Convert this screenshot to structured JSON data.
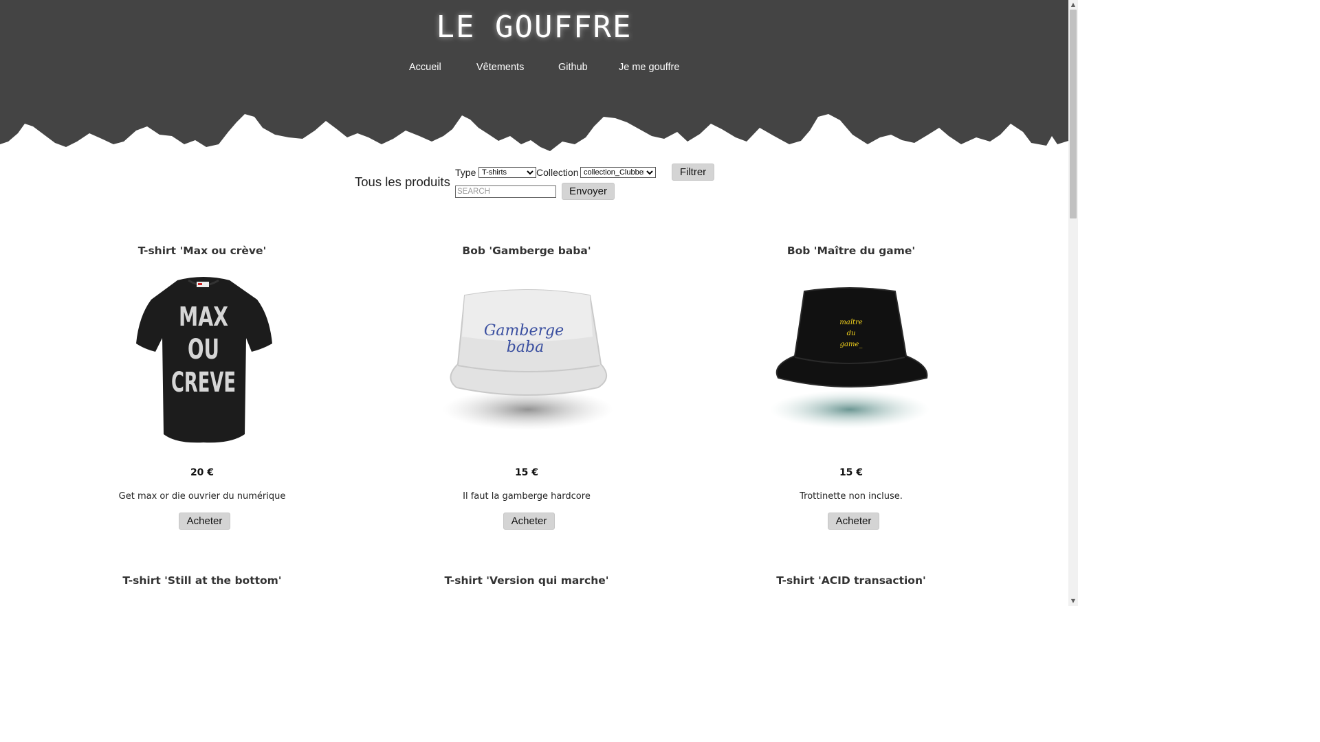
{
  "site": {
    "title": "LE GOUFFRE"
  },
  "nav": {
    "items": [
      "Accueil",
      "Vêtements",
      "Github",
      "Je me gouffre"
    ]
  },
  "filter": {
    "heading": "Tous les produits",
    "type_label": "Type :",
    "type_value": "T-shirts",
    "collection_label": "Collection :",
    "collection_value": "collection_Clubber",
    "filter_button": "Filtrer",
    "search_placeholder": "SEARCH",
    "send_button": "Envoyer"
  },
  "products": [
    {
      "title": "T-shirt 'Max ou crève'",
      "price": "20 €",
      "description": "Get max or die ouvrier du numérique",
      "buy_label": "Acheter",
      "image_text": [
        "MAX",
        "OU",
        "CREVE"
      ]
    },
    {
      "title": "Bob 'Gamberge baba'",
      "price": "15 €",
      "description": "Il faut la gamberge hardcore",
      "buy_label": "Acheter",
      "image_text": [
        "Gamberge",
        "baba"
      ]
    },
    {
      "title": "Bob 'Maître du game'",
      "price": "15 €",
      "description": "Trottinette non incluse.",
      "buy_label": "Acheter",
      "image_text": [
        "maître",
        "du",
        "game_"
      ]
    },
    {
      "title": "T-shirt 'Still at the bottom'"
    },
    {
      "title": "T-shirt 'Version qui marche'"
    },
    {
      "title": "T-shirt 'ACID transaction'"
    }
  ],
  "colors": {
    "header_bg": "#444444",
    "button_bg": "#d4d4d4",
    "hat_text_blue": "#3a4fa0",
    "hat_text_yellow": "#f3d21c"
  }
}
